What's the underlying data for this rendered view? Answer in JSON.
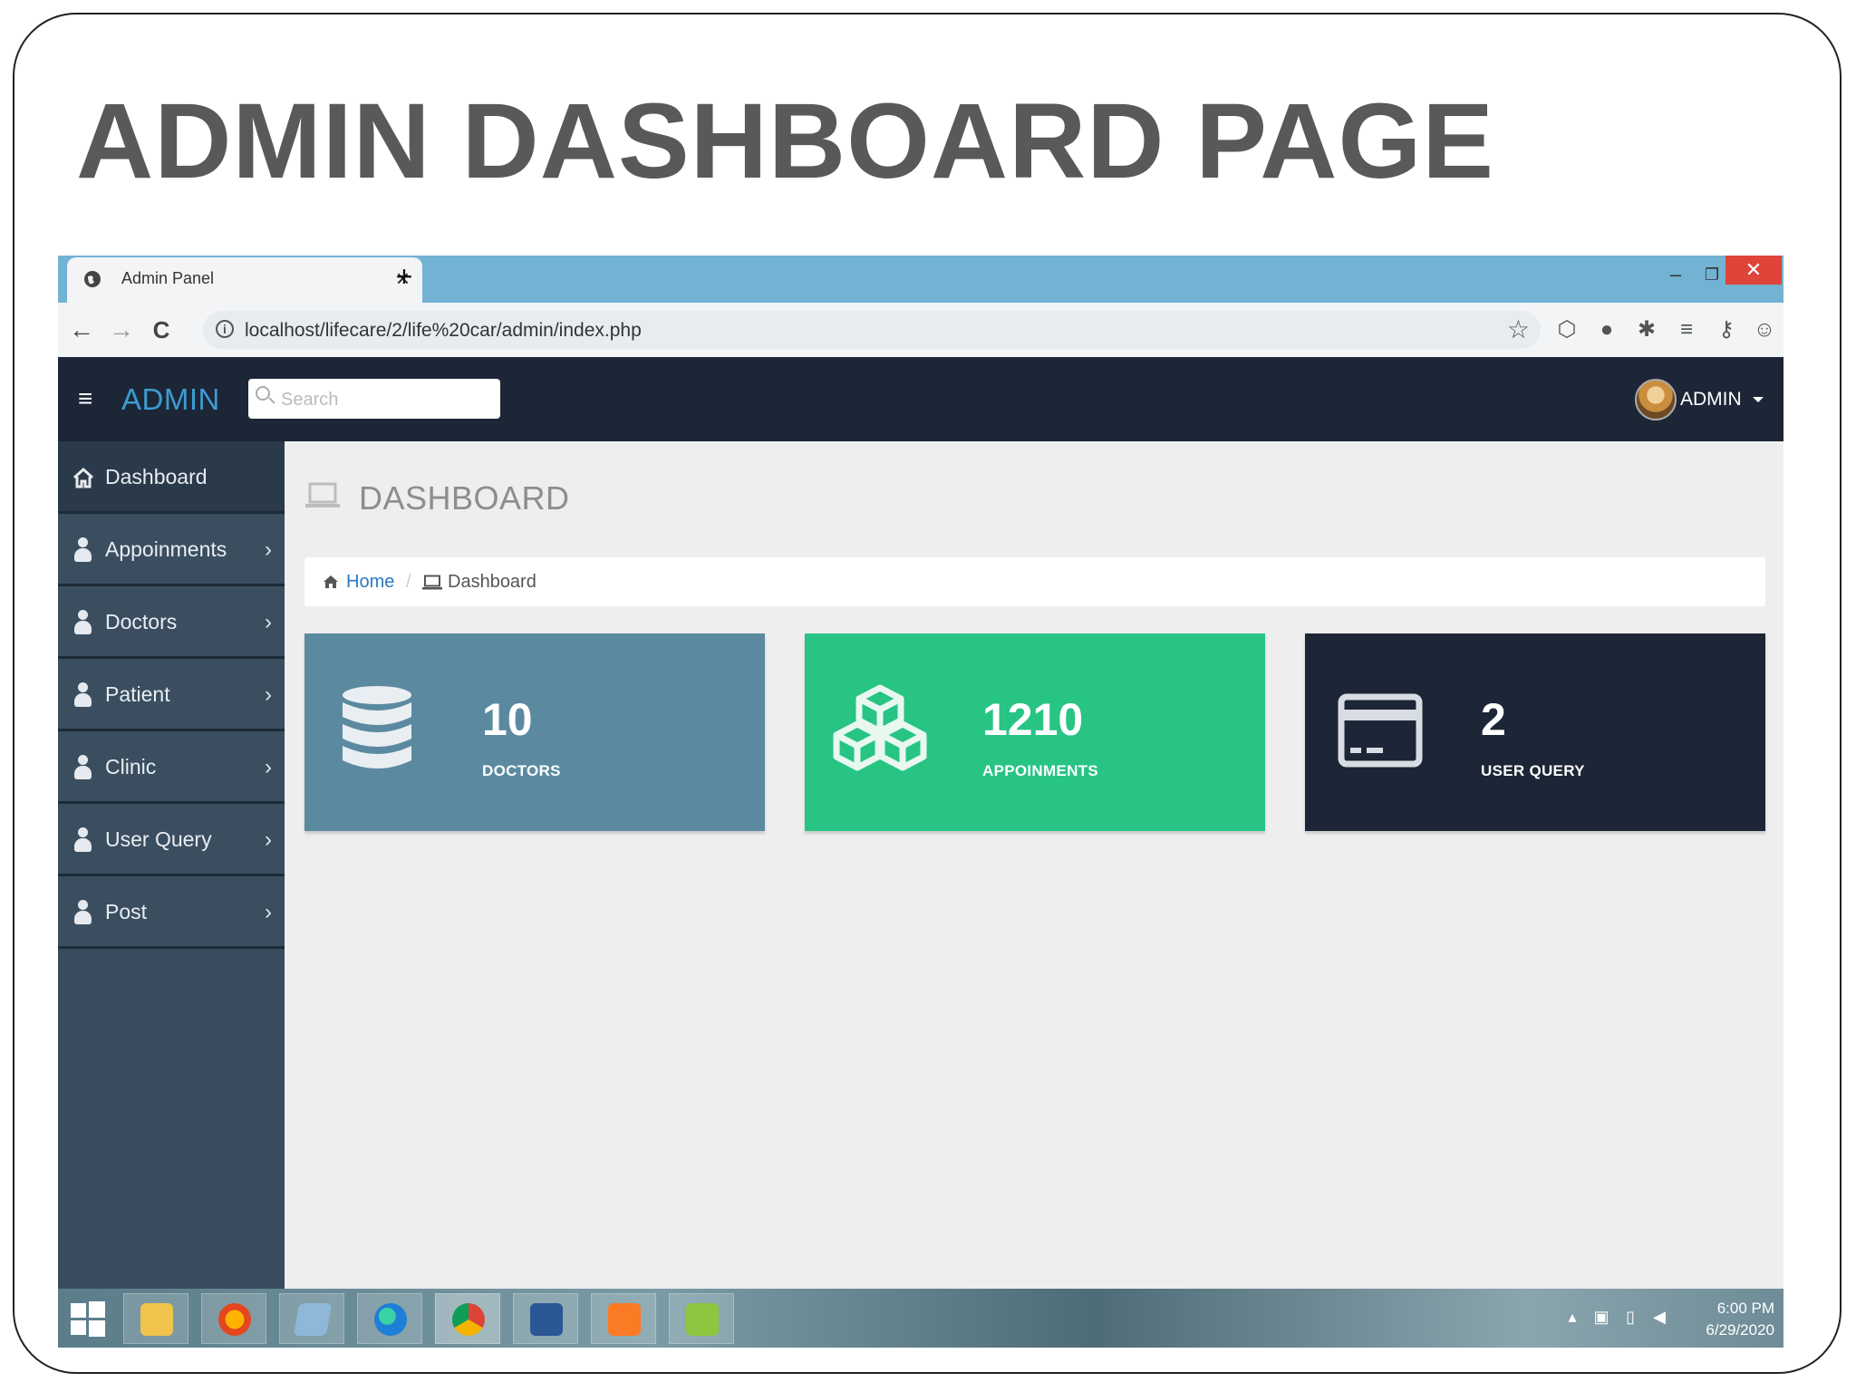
{
  "slide": {
    "title": "ADMIN DASHBOARD PAGE"
  },
  "browser": {
    "tab_title": "Admin Panel",
    "tab_close": "×",
    "new_tab": "+",
    "url": "localhost/lifecare/2/life%20car/admin/index.php",
    "window": {
      "minimize": "–",
      "maximize": "❐",
      "close": "✕"
    },
    "nav": {
      "back": "←",
      "forward": "→",
      "reload": "C"
    }
  },
  "header": {
    "brand": "ADMIN",
    "search_placeholder": "Search",
    "user_name": "ADMIN"
  },
  "sidebar": {
    "items": [
      {
        "label": "Dashboard",
        "icon": "home-icon",
        "active": true
      },
      {
        "label": "Appoinments",
        "icon": "user-icon",
        "chevron": "›"
      },
      {
        "label": "Doctors",
        "icon": "user-icon",
        "chevron": "›"
      },
      {
        "label": "Patient",
        "icon": "user-icon",
        "chevron": "›"
      },
      {
        "label": "Clinic",
        "icon": "user-icon",
        "chevron": "›"
      },
      {
        "label": "User Query",
        "icon": "user-icon",
        "chevron": "›"
      },
      {
        "label": "Post",
        "icon": "user-icon",
        "chevron": "›"
      }
    ]
  },
  "main": {
    "heading": "DASHBOARD",
    "breadcrumb": {
      "home": "Home",
      "separator": "/",
      "current": "Dashboard"
    },
    "stats": [
      {
        "value": "10",
        "label": "DOCTORS",
        "icon": "database-icon",
        "color": "#5b8aa0"
      },
      {
        "value": "1210",
        "label": "APPOINMENTS",
        "icon": "cubes-icon",
        "color": "#27c484"
      },
      {
        "value": "2",
        "label": "USER QUERY",
        "icon": "credit-card-icon",
        "color": "#1c2636"
      }
    ]
  },
  "taskbar": {
    "apps": [
      "file-explorer",
      "firefox",
      "notepad",
      "edge",
      "chrome",
      "word",
      "xampp",
      "notepad-plus-plus"
    ],
    "clock_time": "6:00 PM",
    "clock_date": "6/29/2020"
  }
}
